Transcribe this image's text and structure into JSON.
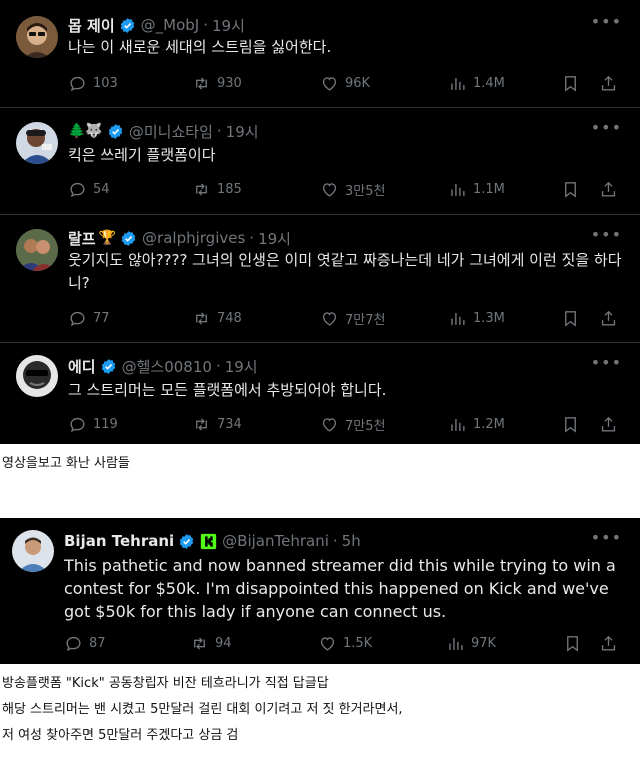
{
  "tweets": [
    {
      "name": "몹 제이",
      "handle": "@_MobJ",
      "time": "19시",
      "text": "나는 이 새로운 세대의 스트림을 싫어한다.",
      "replies": "103",
      "reposts": "930",
      "likes": "96K",
      "views": "1.4M",
      "name_emoji": "",
      "avatar": "avatar-mob"
    },
    {
      "name": "",
      "handle": "@미니쇼타임",
      "time": "19시",
      "text": "킥은 쓰레기 플랫폼이다",
      "replies": "54",
      "reposts": "185",
      "likes": "3만5천",
      "views": "1.1M",
      "name_emoji": "🌲🐺",
      "avatar": "avatar-mini"
    },
    {
      "name": "랄프",
      "handle": "@ralphjrgives",
      "time": "19시",
      "text": "웃기지도 않아???? 그녀의 인생은 이미 엿같고 짜증나는데 네가 그녀에게 이런 짓을 하다니?",
      "replies": "77",
      "reposts": "748",
      "likes": "7만7천",
      "views": "1.3M",
      "name_emoji": "🏆",
      "avatar": "avatar-ralph"
    },
    {
      "name": "에디",
      "handle": "@헬스00810",
      "time": "19시",
      "text": "그 스트리머는 모든 플랫폼에서 추방되어야 합니다.",
      "replies": "119",
      "reposts": "734",
      "likes": "7만5천",
      "views": "1.2M",
      "name_emoji": "",
      "avatar": "avatar-eddie"
    }
  ],
  "caption1": "영상을보고 화난 사람들",
  "bijan": {
    "name": "Bijan Tehrani",
    "handle": "@BijanTehrani",
    "time": "5h",
    "text": "This pathetic and now banned streamer did this while trying to win a contest for $50k. I'm disappointed this happened on Kick and we've got $50k for this lady if anyone can connect us.",
    "replies": "87",
    "reposts": "94",
    "likes": "1.5K",
    "views": "97K"
  },
  "captions_bottom": [
    "방송플랫폼 \"Kick\" 공동창립자 비잔 테흐라니가 직접 답글답",
    "해당 스트리머는 밴 시켰고 5만달러 걸린 대회 이기려고 저 짓 한거라면서,",
    "저 여성 찾아주면 5만달러 주겠다고 상금 검"
  ],
  "colors": {
    "panel_bg": "#000000",
    "text": "#e7e9ea",
    "muted": "#71767b",
    "verified": "#1d9bf0",
    "kick": "#53fc18"
  },
  "icons": [
    "more-icon",
    "reply-icon",
    "repost-icon",
    "like-icon",
    "views-icon",
    "bookmark-icon",
    "share-icon",
    "verified-badge-icon",
    "kick-logo-icon"
  ]
}
